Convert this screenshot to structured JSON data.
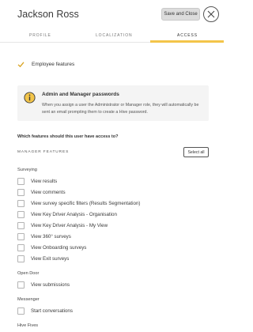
{
  "header": {
    "title": "Jackson Ross",
    "save_close_label": "Save and Close"
  },
  "tabs": [
    {
      "label": "PROFILE"
    },
    {
      "label": "LOCALIZATION"
    },
    {
      "label": "ACCESS"
    }
  ],
  "active_tab": "ACCESS",
  "employee_features": {
    "label": "Employee features",
    "checked": true
  },
  "info": {
    "title": "Admin and Manager passwords",
    "text": "When you assign a user the Administrator or Manager role, they will automatically be sent an email prompting them to create a Hive password."
  },
  "question": "Which features should this user have access to?",
  "manager_features_label": "MANAGER FEATURES",
  "select_all_label": "Select all",
  "sections": {
    "surveying": {
      "label": "Surveying",
      "items": [
        "View results",
        "View comments",
        "View survey specific filters (Results Segmentation)",
        "View Key Driver Analysis - Organisation",
        "View Key Driver Analysis - My View",
        "View 360° surveys",
        "View Onboarding surveys",
        "View Exit surveys"
      ]
    },
    "open_door": {
      "label": "Open Door",
      "items": [
        "View submissions"
      ]
    },
    "messenger": {
      "label": "Messenger",
      "items": [
        "Start conversations"
      ]
    },
    "hive_fives": {
      "label": "Hive Fives"
    }
  },
  "colors": {
    "accent": "#f3c54a",
    "check": "#d9a21f"
  }
}
